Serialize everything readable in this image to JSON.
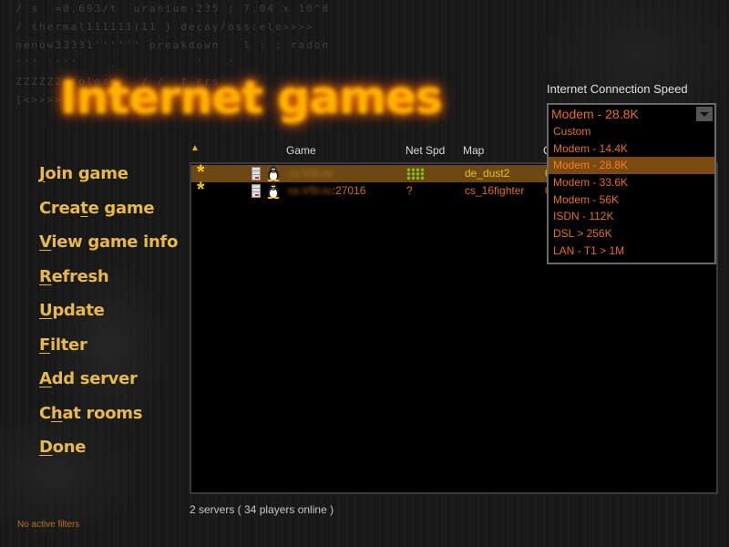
{
  "title": "Internet games",
  "background_code_lines": [
    "  / s  =0.693/t  uranium-235 : 7.04 x 10^8",
    "  / thermal111111(11 } decay/oss:ele>>>>",
    "  nenow33331'''''' preakdown   l : : radon",
    "  ''' ''''    .          '   '        ",
    "  ZZZZZ2 solose   / /  f-crs          ",
    "  [<>>>>>>>                            "
  ],
  "nav": {
    "items": [
      {
        "label": "Join game",
        "mnemonic_index": 0
      },
      {
        "label": "Create game",
        "mnemonic_index": 4
      },
      {
        "label": "View game info",
        "mnemonic_index": 0
      },
      {
        "label": "Refresh",
        "mnemonic_index": 0
      },
      {
        "label": "Update",
        "mnemonic_index": 0
      },
      {
        "label": "Filter",
        "mnemonic_index": 0
      },
      {
        "label": "Add server",
        "mnemonic_index": 0
      },
      {
        "label": "Chat rooms",
        "mnemonic_index": 1
      },
      {
        "label": "Done",
        "mnemonic_index": 0
      }
    ]
  },
  "filter_status": "No active filters",
  "server_list": {
    "sort_indicator": "▲",
    "columns": [
      {
        "key": "game",
        "label": "Game"
      },
      {
        "key": "netspd",
        "label": "Net Spd"
      },
      {
        "key": "map",
        "label": "Map"
      },
      {
        "key": "extra",
        "label": "C"
      }
    ],
    "rows": [
      {
        "favorite_icon": "star",
        "server_icon": "dedicated-server",
        "os_icon": "linux-tux",
        "game": "cs.VSI.ru",
        "game_suffix": "",
        "netspd": "signal-dots",
        "map": "de_dust2",
        "extra": "0",
        "selected": true
      },
      {
        "favorite_icon": "star",
        "server_icon": "dedicated-server",
        "os_icon": "linux-tux",
        "game": "cs.VSI.ru",
        "game_suffix": ":27016",
        "netspd": "?",
        "map": "cs_16fighter",
        "extra": "0",
        "selected": false
      }
    ]
  },
  "status_text": "2 servers ( 34 players online )",
  "connection_speed": {
    "label": "Internet Connection Speed",
    "current": "Modem - 28.8K",
    "options": [
      "Custom",
      "Modem - 14.4K",
      "Modem - 28.8K",
      "Modem - 33.6K",
      "Modem - 56K",
      "ISDN - 112K",
      "DSL > 256K",
      "LAN - T1 > 1M"
    ],
    "selected_index": 2
  },
  "colors": {
    "accent_gold": "#e8b84a",
    "accent_orange": "#e07020",
    "selection_brown": "#6e4812",
    "net_speed_green": "#80c020"
  }
}
